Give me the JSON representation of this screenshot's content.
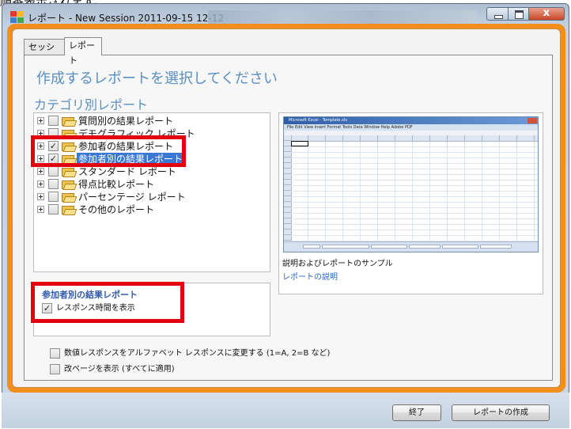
{
  "window": {
    "title": "レポート - New Session 2011-09-15 12-12",
    "top_text": "順番表示されます。",
    "close_symbol": "x"
  },
  "tabs": [
    {
      "label": "セッション",
      "active": false
    },
    {
      "label": "レポート",
      "active": true
    }
  ],
  "headings": {
    "main": "作成するレポートを選択してください",
    "sub": "カテゴリ別レポート"
  },
  "report_tree": [
    {
      "label": "質問別の結果レポート",
      "checked": false,
      "selected": false
    },
    {
      "label": "デモグラフィック レポート",
      "checked": false,
      "selected": false
    },
    {
      "label": "参加者の結果レポート",
      "checked": true,
      "selected": false
    },
    {
      "label": "参加者別の結果レポート",
      "checked": true,
      "selected": true
    },
    {
      "label": "スタンダード レポート",
      "checked": false,
      "selected": false
    },
    {
      "label": "得点比較レポート",
      "checked": false,
      "selected": false
    },
    {
      "label": "パーセンテージ レポート",
      "checked": false,
      "selected": false
    },
    {
      "label": "その他のレポート",
      "checked": false,
      "selected": false
    }
  ],
  "preview": {
    "excel_title": "Microsoft Excel - Template.xls",
    "excel_menu": "File  Edit  View  Insert  Format  Tools  Data  Window  Help  Adobe PDF",
    "caption": "説明およびレポートのサンプル",
    "link": "レポートの説明"
  },
  "options": {
    "title": "参加者別の結果レポート",
    "show_response_time": {
      "label": "レスポンス時間を表示",
      "checked": true
    }
  },
  "global_options": [
    {
      "label": "数値レスポンスをアルファベット レスポンスに変更する (1=A, 2=B など)",
      "checked": false
    },
    {
      "label": "改ページを表示 (すべてに適用)",
      "checked": false
    }
  ],
  "buttons": {
    "exit": "終了",
    "create": "レポートの作成"
  },
  "colors": {
    "accent_orange": "#f28e1e",
    "heading_blue": "#5a8fc0",
    "highlight_red": "#e3000f",
    "selection_blue": "#3a78d6"
  }
}
